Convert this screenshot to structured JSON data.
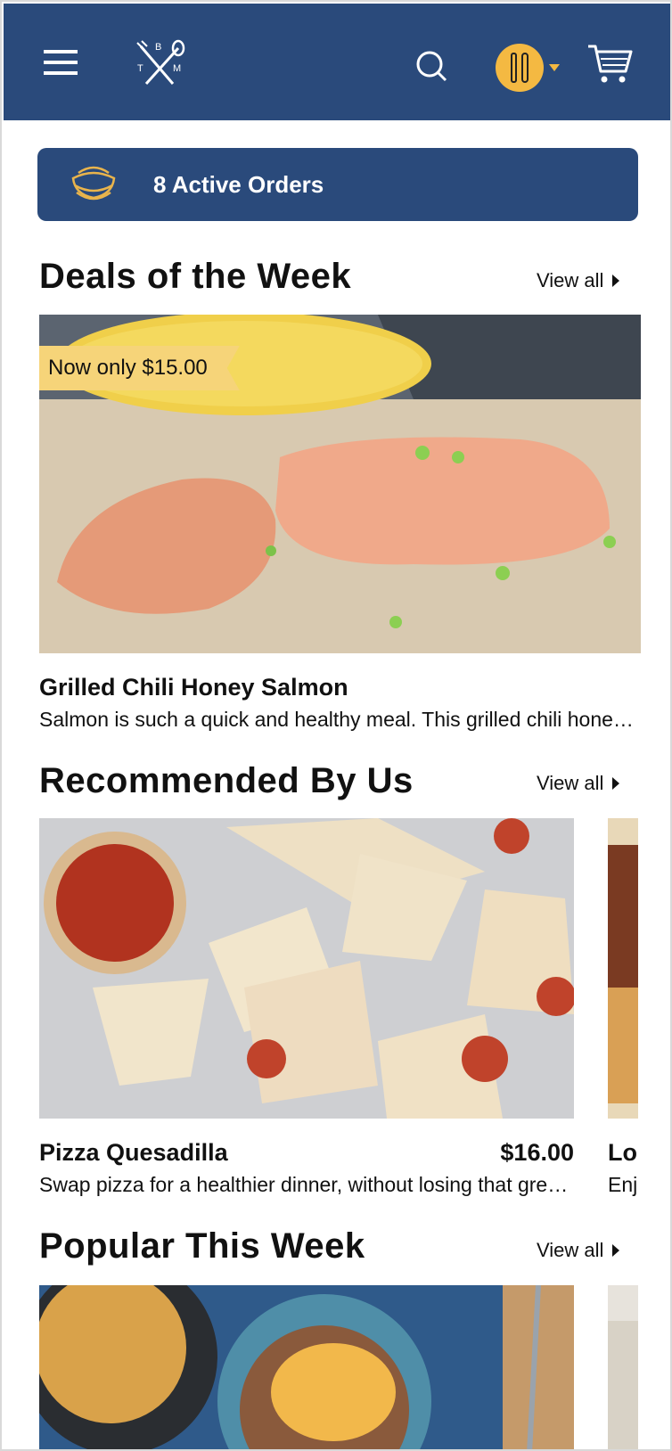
{
  "header": {
    "menu_icon": "hamburger-menu-icon",
    "logo_letters": [
      "B",
      "T",
      "M"
    ],
    "search_icon": "search-icon",
    "avatar_icon": "fork-knife-icon",
    "cart_icon": "cart-icon"
  },
  "orders": {
    "label": "8 Active Orders",
    "icon": "stacked-bowls-icon"
  },
  "deals": {
    "title": "Deals of the Week",
    "view_all": "View all",
    "badge": "Now only $15.00",
    "item_title": "Grilled Chili Honey Salmon",
    "item_desc": "Salmon is such a quick and healthy meal. This grilled chili honey salmon is perfect"
  },
  "recommended": {
    "title": "Recommended By Us",
    "view_all": "View all",
    "items": [
      {
        "title": "Pizza Quesadilla",
        "price": "$16.00",
        "desc": "Swap pizza for a healthier dinner, without losing that great taste"
      },
      {
        "title": "Lo",
        "price": "",
        "desc": "Enj"
      }
    ]
  },
  "popular": {
    "title": "Popular This Week",
    "view_all": "View all"
  },
  "colors": {
    "brand_blue": "#2a4a7b",
    "accent_yellow": "#f4b942",
    "badge_yellow": "#f6d479"
  }
}
